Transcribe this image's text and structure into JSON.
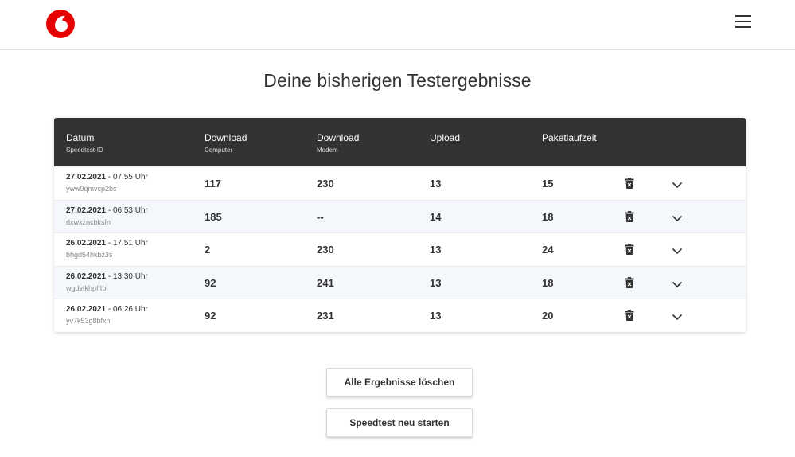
{
  "header": {
    "logo": "vodafone-logo",
    "menu_icon": "hamburger-menu-icon"
  },
  "title": "Deine bisherigen Testergebnisse",
  "table": {
    "columns": {
      "date": {
        "label": "Datum",
        "sub": "Speedtest-ID"
      },
      "download_computer": {
        "label": "Download",
        "sub": "Computer"
      },
      "download_modem": {
        "label": "Download",
        "sub": "Modem"
      },
      "upload": {
        "label": "Upload",
        "sub": ""
      },
      "latency": {
        "label": "Paketlaufzeit",
        "sub": ""
      }
    },
    "rows": [
      {
        "date": "27.02.2021",
        "time": " - 07:55 Uhr",
        "id": "yww9qmvcp2bs",
        "download_computer": "117",
        "download_modem": "230",
        "upload": "13",
        "latency": "15"
      },
      {
        "date": "27.02.2021",
        "time": " - 06:53 Uhr",
        "id": "dxwxzncbksfn",
        "download_computer": "185",
        "download_modem": "--",
        "upload": "14",
        "latency": "18"
      },
      {
        "date": "26.02.2021",
        "time": " - 17:51 Uhr",
        "id": "bhgd54hkbz3s",
        "download_computer": "2",
        "download_modem": "230",
        "upload": "13",
        "latency": "24"
      },
      {
        "date": "26.02.2021",
        "time": " - 13:30 Uhr",
        "id": "wgdvtkhpfftb",
        "download_computer": "92",
        "download_modem": "241",
        "upload": "13",
        "latency": "18"
      },
      {
        "date": "26.02.2021",
        "time": " - 06:26 Uhr",
        "id": "yv7k53g8bfxh",
        "download_computer": "92",
        "download_modem": "231",
        "upload": "13",
        "latency": "20"
      }
    ]
  },
  "buttons": {
    "clear_all": "Alle Ergebnisse löschen",
    "restart": "Speedtest neu starten"
  },
  "colors": {
    "brand_red": "#e60000",
    "header_dark": "#333333",
    "row_alt": "#f4f7fb"
  }
}
